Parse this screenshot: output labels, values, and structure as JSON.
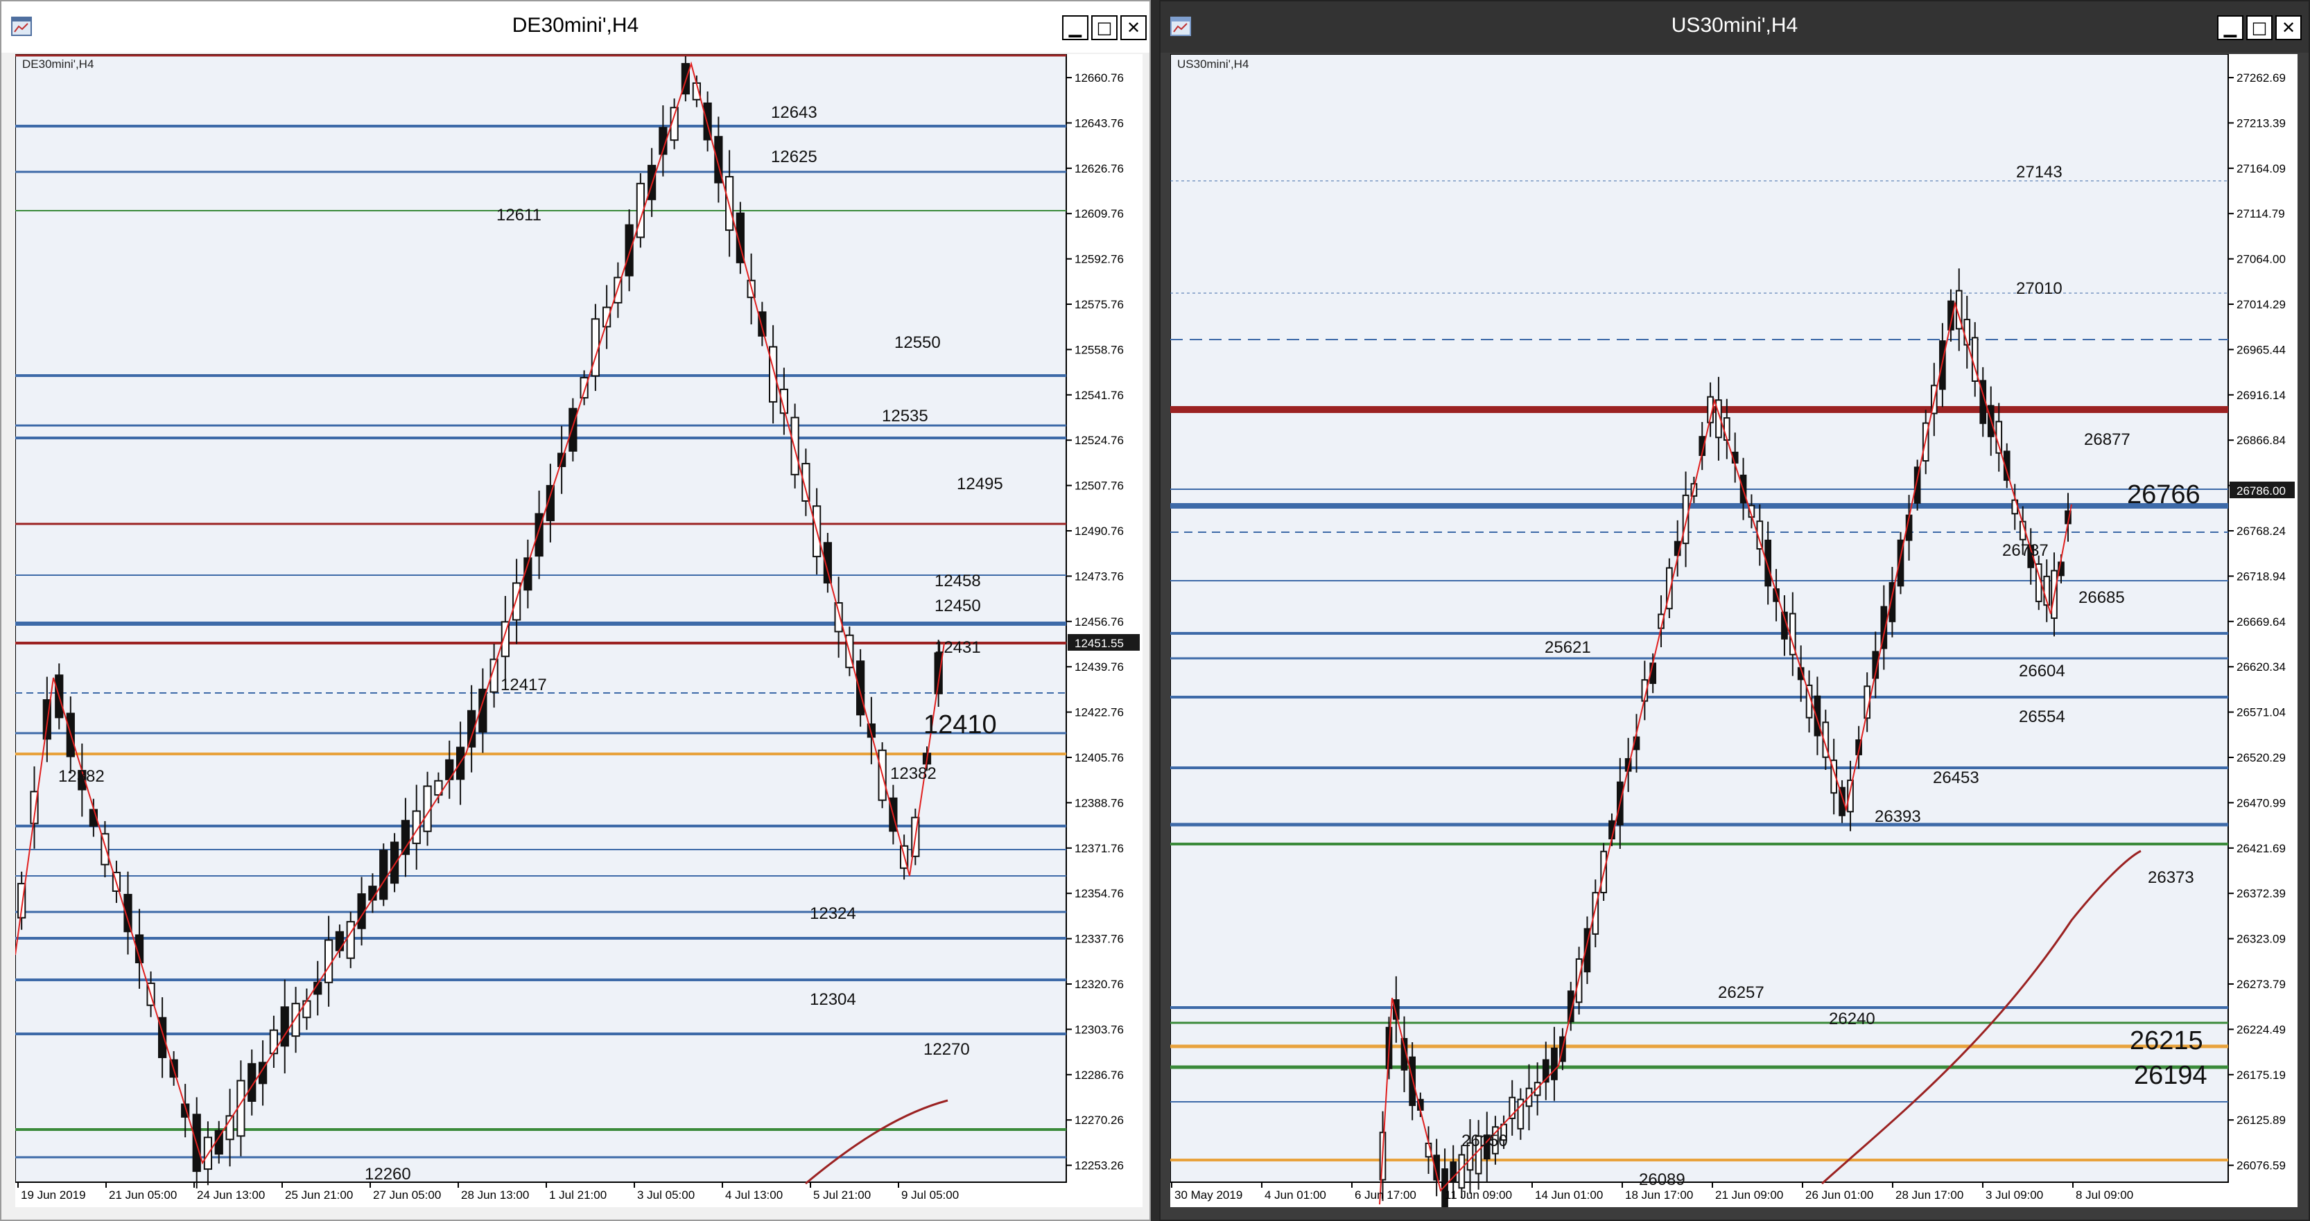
{
  "left": {
    "window_title": "DE30mini',H4",
    "chart_label": "DE30mini',H4",
    "price_axis": [
      "12660.76",
      "12643.76",
      "12626.76",
      "12609.76",
      "12592.76",
      "12575.76",
      "12558.76",
      "12541.76",
      "12524.76",
      "12507.76",
      "12490.76",
      "12473.76",
      "12456.76",
      "12439.76",
      "12422.76",
      "12405.76",
      "12388.76",
      "12371.76",
      "12354.76",
      "12337.76",
      "12320.76",
      "12303.76",
      "12286.76",
      "12270.26",
      "12253.26"
    ],
    "current_price": "12451.55",
    "time_axis": [
      "19 Jun 2019",
      "21 Jun 05:00",
      "24 Jun 13:00",
      "25 Jun 21:00",
      "27 Jun 05:00",
      "28 Jun 13:00",
      "1 Jul 21:00",
      "3 Jul 05:00",
      "4 Jul 13:00",
      "5 Jul 21:00",
      "9 Jul 05:00"
    ],
    "annotations": [
      "12643",
      "12625",
      "12611",
      "12550",
      "12535",
      "12495",
      "12458",
      "12450",
      "12431",
      "12417",
      "12410",
      "12382",
      "12382",
      "12324",
      "12304",
      "12270",
      "12260"
    ]
  },
  "right": {
    "window_title": "US30mini',H4",
    "chart_label": "US30mini',H4",
    "price_axis": [
      "27262.69",
      "27213.39",
      "27164.09",
      "27114.79",
      "27064.00",
      "27014.29",
      "26965.44",
      "26916.14",
      "26866.84",
      "26817.54",
      "26768.24",
      "26718.94",
      "26669.64",
      "26620.34",
      "26571.04",
      "26520.29",
      "26470.99",
      "26421.69",
      "26372.39",
      "26323.09",
      "26273.79",
      "26224.49",
      "26175.19",
      "26125.89",
      "26076.59"
    ],
    "current_price": "26786.00",
    "time_axis": [
      "30 May 2019",
      "4 Jun 01:00",
      "6 Jun 17:00",
      "11 Jun 09:00",
      "14 Jun 01:00",
      "18 Jun 17:00",
      "21 Jun 09:00",
      "26 Jun 01:00",
      "28 Jun 17:00",
      "3 Jul 09:00",
      "8 Jul 09:00"
    ],
    "annotations": [
      "27143",
      "27010",
      "26877",
      "26766",
      "26737",
      "26685",
      "25621",
      "26604",
      "26554",
      "26453",
      "26393",
      "26373",
      "26257",
      "26240",
      "26215",
      "26194",
      "26150",
      "26089"
    ]
  },
  "colors": {
    "blue_level": "#3d6aa8",
    "red_level": "#9b2222",
    "orange_level": "#e8a23c",
    "green_level": "#3a8a3a",
    "zigzag": "#e0201f"
  },
  "icons": {
    "app": "chart-window-icon",
    "minimize": "minimize-icon",
    "maximize": "maximize-icon",
    "close": "close-icon"
  }
}
